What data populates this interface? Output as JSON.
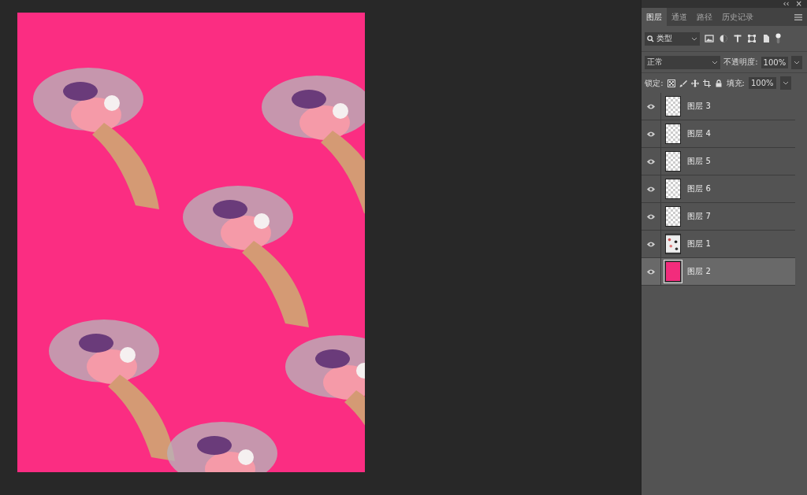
{
  "panel": {
    "collapse_glyph": "‹‹",
    "close_glyph": "×",
    "tabs": [
      {
        "label": "图层",
        "selected": true
      },
      {
        "label": "通道",
        "selected": false
      },
      {
        "label": "路径",
        "selected": false
      },
      {
        "label": "历史记录",
        "selected": false
      }
    ],
    "filter": {
      "value": "类型"
    },
    "blend_mode": {
      "value": "正常"
    },
    "opacity": {
      "label": "不透明度:",
      "value": "100%"
    },
    "lock": {
      "label": "锁定:"
    },
    "fill": {
      "label": "填充:",
      "value": "100%"
    },
    "layers": [
      {
        "name": "图层 3",
        "visible": true,
        "selected": false,
        "thumbnail": {
          "kind": "transparent"
        }
      },
      {
        "name": "图层 4",
        "visible": true,
        "selected": false,
        "thumbnail": {
          "kind": "transparent"
        }
      },
      {
        "name": "图层 5",
        "visible": true,
        "selected": false,
        "thumbnail": {
          "kind": "transparent"
        }
      },
      {
        "name": "图层 6",
        "visible": true,
        "selected": false,
        "thumbnail": {
          "kind": "transparent"
        }
      },
      {
        "name": "图层 7",
        "visible": true,
        "selected": false,
        "thumbnail": {
          "kind": "transparent"
        }
      },
      {
        "name": "图层 1",
        "visible": true,
        "selected": false,
        "thumbnail": {
          "kind": "pattern"
        }
      },
      {
        "name": "图层 2",
        "visible": true,
        "selected": true,
        "thumbnail": {
          "kind": "fill",
          "color": "#f22c7c"
        }
      }
    ]
  }
}
